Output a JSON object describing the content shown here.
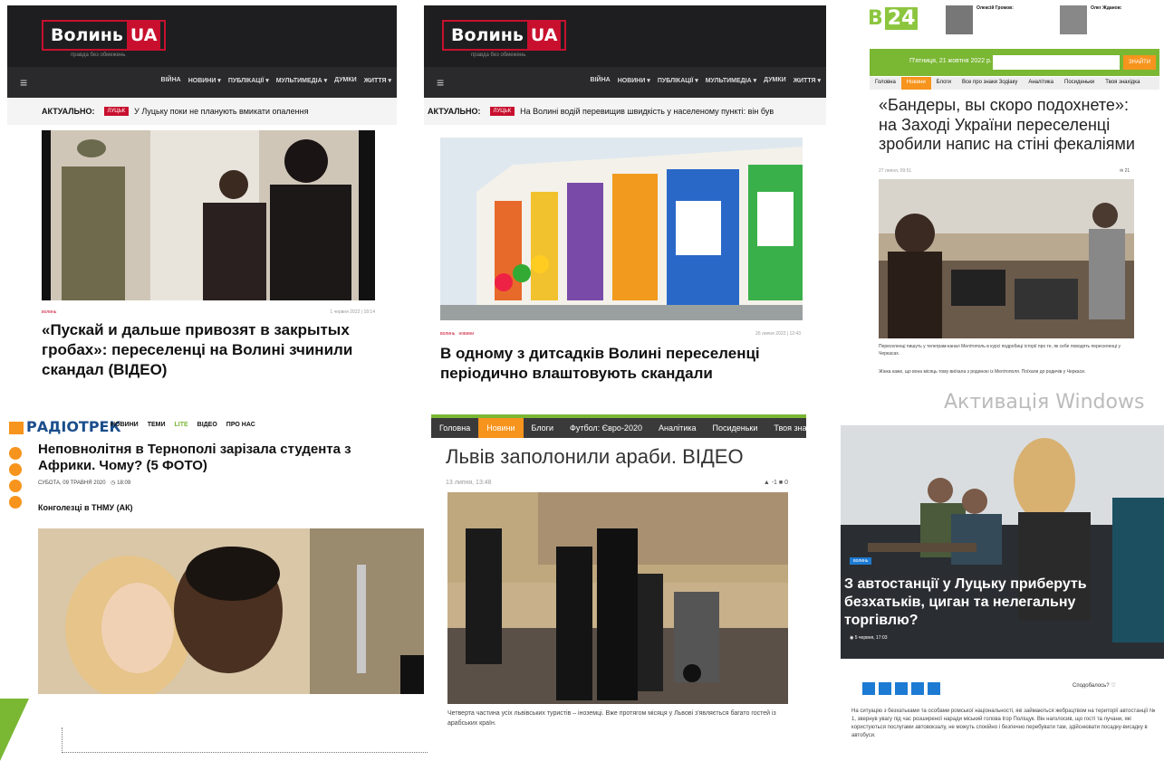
{
  "panel1": {
    "logo_word": "Волинь",
    "logo_ua": "UA",
    "tagline": "правда без обмежень",
    "menu": [
      "ВІЙНА",
      "НОВИНИ ▾",
      "ПУБЛІКАЦІЇ ▾",
      "МУЛЬТИМЕДІА ▾",
      "ДУМКИ",
      "ЖИТТЯ ▾"
    ],
    "ticker_label": "АКТУАЛЬНО:",
    "ticker_badge": "ЛУЦЬК",
    "ticker_text": "У Луцьку поки не планують вмикати опалення",
    "category": "волинь",
    "date": "1 червня 2022 | 18:14",
    "title": "«Пускай и дальше привозят в закрытых гробах»: переселенці на Волині зчинили скандал (ВІДЕО)"
  },
  "panel2": {
    "logo_word": "Волинь",
    "logo_ua": "UA",
    "tagline": "правда без обмежень",
    "menu": [
      "ВІЙНА",
      "НОВИНИ ▾",
      "ПУБЛІКАЦІЇ ▾",
      "МУЛЬТИМЕДІА ▾",
      "ДУМКИ",
      "ЖИТТЯ ▾"
    ],
    "ticker_label": "АКТУАЛЬНО:",
    "ticker_badge": "ЛУЦЬК",
    "ticker_text": "На Волині водій перевищив швидкість у населеному пункті: він був",
    "category": "волинь   новини",
    "date": "26 липня 2022 | 12:43",
    "title": "В одному з дитсадків Волині переселенці періодично влаштовують скандали"
  },
  "panel3": {
    "logo": "B",
    "logo_num": "24",
    "author1": "Олексій Громов:",
    "author2": "Олег Жданов:",
    "date_bar": "П'ятниця, 21 жовтня 2022 р.",
    "search_btn": "ЗНАЙТИ",
    "nav": [
      "Головна",
      "Новини",
      "Блоги",
      "Все про знаки Зодіаку",
      "Аналітика",
      "Посиденьки",
      "Твоя знахідка"
    ],
    "title": "«Бандеры, вы скоро подохнете»: на Заході України переселенці зробили напис на стіні фекаліями",
    "date": "27 липня, 09:51",
    "comments": "21",
    "caption": "Переселенці пишуть у телеграм-канал Мелітополь в курсі подробиці історії про те, як себе поводять переселенці у Черкасах.",
    "caption2": "Жінка каже, що вона місяць тому виїхала з родиною із Мелітополя. Поїхали до родичів у Черкаси."
  },
  "panel4": {
    "logo": "РАДІОТРЕК",
    "menu": [
      "НОВИНИ",
      "ТЕМИ",
      "LITE",
      "ВІДЕО",
      "ПРО НАС"
    ],
    "title": "Неповнолітня в Тернополі зарізала студента з Африки. Чому? (5 ФОТО)",
    "date": "СУБОТА, 09 ТРАВНЯ 2020",
    "time": "18:09",
    "subtitle": "Конголезці в ТНМУ (АК)"
  },
  "panel5": {
    "nav": [
      "Головна",
      "Новини",
      "Блоги",
      "Футбол: Євро-2020",
      "Аналітика",
      "Посиденьки",
      "Твоя знахідка"
    ],
    "title": "Львів заполонили араби. ВІДЕО",
    "date": "13 липня, 13:48",
    "votes": "-1",
    "comments": "0",
    "caption": "Четверта частина усіх львівських туристів – іноземці. Вже протягом місяця у Львові з'являється багато гостей із арабських країн."
  },
  "panel6": {
    "category": "волинь",
    "title": "З автостанції у Луцьку приберуть безхатьків, циган та нелегальну торгівлю?",
    "meta": "5 червня, 17:03",
    "likes_label": "Сподобалось?",
    "body": "На ситуацію з безхатьками та особами ромської національності, які займаються жебрацтвом на території автостанції № 1, звернув увагу під час розширеної наради міський голова Ігор Поліщук. Він наголосив, що гості та лучани, які користуються послугами автовокзалу, не можуть спокійно і безпечно перебувати там, здійснювати посадку-висадку в автобуси."
  },
  "watermark": "Активація Windows"
}
